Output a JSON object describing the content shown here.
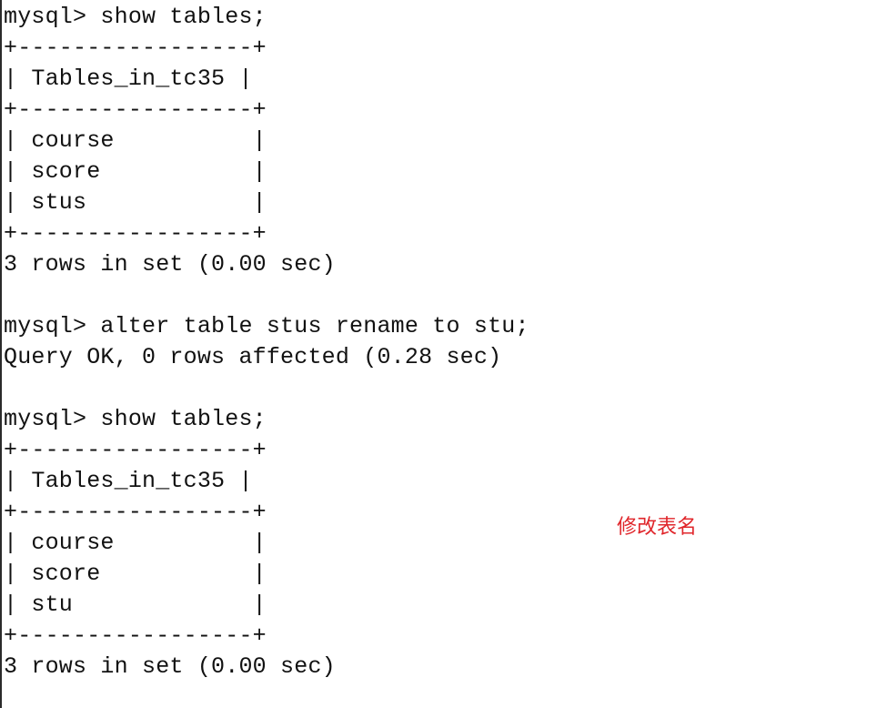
{
  "terminal": {
    "lines": [
      "mysql> show tables;",
      "+-----------------+",
      "| Tables_in_tc35 |",
      "+-----------------+",
      "| course          |",
      "| score           |",
      "| stus            |",
      "+-----------------+",
      "3 rows in set (0.00 sec)",
      "",
      "mysql> alter table stus rename to stu;",
      "Query OK, 0 rows affected (0.28 sec)",
      "",
      "mysql> show tables;",
      "+-----------------+",
      "| Tables_in_tc35 |",
      "+-----------------+",
      "| course          |",
      "| score           |",
      "| stu             |",
      "+-----------------+",
      "3 rows in set (0.00 sec)"
    ]
  },
  "annotation": {
    "text": "修改表名",
    "color": "#e0262b"
  }
}
